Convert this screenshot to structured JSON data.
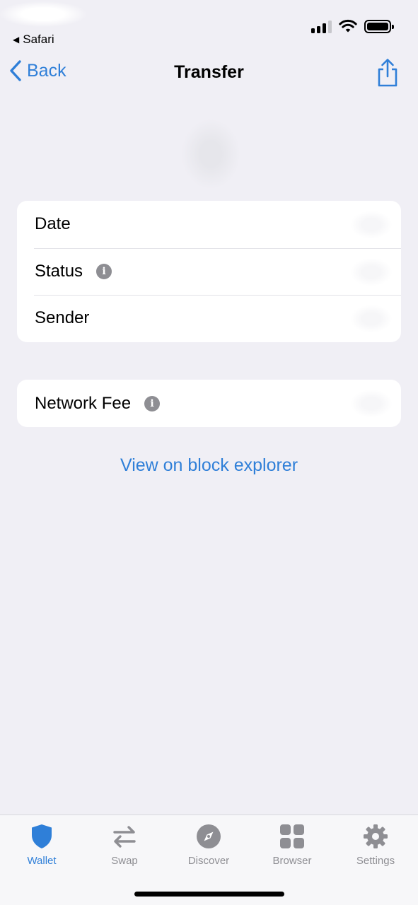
{
  "status_bar": {
    "back_app": "Safari"
  },
  "nav": {
    "back_label": "Back",
    "title": "Transfer"
  },
  "details": {
    "rows": [
      {
        "label": "Date"
      },
      {
        "label": "Status"
      },
      {
        "label": "Sender"
      }
    ]
  },
  "fee": {
    "label": "Network Fee"
  },
  "explorer_link": "View on block explorer",
  "tabs": [
    {
      "label": "Wallet",
      "icon": "shield-icon",
      "active": true
    },
    {
      "label": "Swap",
      "icon": "swap-arrows-icon",
      "active": false
    },
    {
      "label": "Discover",
      "icon": "compass-icon",
      "active": false
    },
    {
      "label": "Browser",
      "icon": "grid-icon",
      "active": false
    },
    {
      "label": "Settings",
      "icon": "gear-icon",
      "active": false
    }
  ],
  "colors": {
    "accent": "#2f7fd8",
    "background": "#f0eff5",
    "inactive": "#8e8e93"
  }
}
